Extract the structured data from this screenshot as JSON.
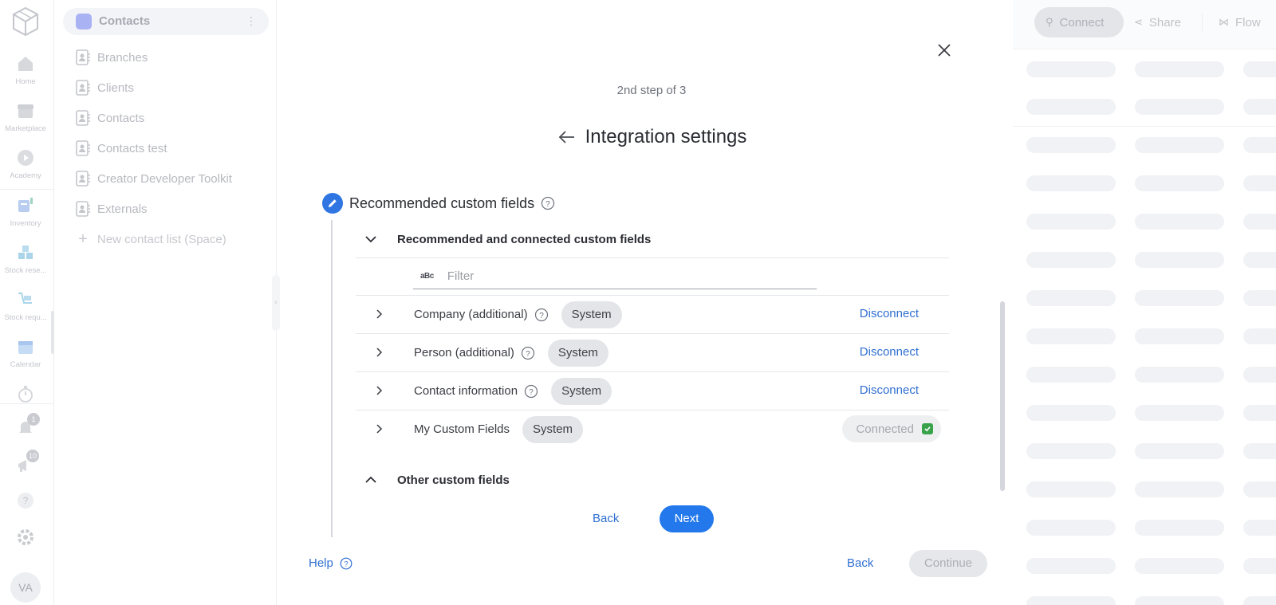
{
  "rail": {
    "items": [
      {
        "label": "Home",
        "icon": "home-icon"
      },
      {
        "label": "Marketplace",
        "icon": "store-icon"
      },
      {
        "label": "Academy",
        "icon": "play-icon"
      },
      {
        "label": "Inventory",
        "icon": "inventory-icon"
      },
      {
        "label": "Stock rese...",
        "icon": "boxes-icon"
      },
      {
        "label": "Stock requ...",
        "icon": "cart-icon"
      },
      {
        "label": "Calendar",
        "icon": "calendar-icon"
      }
    ],
    "notifications_count": "1",
    "announcements_count": "10",
    "avatar_initials": "VA"
  },
  "sidebar": {
    "title": "Contacts",
    "items": [
      {
        "label": "Branches"
      },
      {
        "label": "Clients"
      },
      {
        "label": "Contacts"
      },
      {
        "label": "Contacts test"
      },
      {
        "label": "Creator Developer Toolkit"
      },
      {
        "label": "Externals"
      }
    ],
    "new_item_label": "New contact list (Space)"
  },
  "toolbar": {
    "connect_label": "Connect",
    "share_label": "Share",
    "flow_label": "Flow"
  },
  "modal": {
    "step_text": "2nd step of 3",
    "title": "Integration settings",
    "section_title": "Recommended custom fields",
    "group_connected_label": "Recommended and connected custom fields",
    "filter_placeholder": "Filter",
    "filter_icon_text": "aBc",
    "rows": [
      {
        "name": "Company (additional)",
        "tag": "System",
        "action": "Disconnect",
        "has_help": true
      },
      {
        "name": "Person (additional)",
        "tag": "System",
        "action": "Disconnect",
        "has_help": true
      },
      {
        "name": "Contact information",
        "tag": "System",
        "action": "Disconnect",
        "has_help": true
      },
      {
        "name": "My Custom Fields",
        "tag": "System",
        "status": "Connected",
        "has_help": false
      }
    ],
    "group_other_label": "Other custom fields",
    "inner_back_label": "Back",
    "inner_next_label": "Next",
    "help_label": "Help",
    "footer_back_label": "Back",
    "continue_label": "Continue"
  },
  "colors": {
    "accent": "#2378ec",
    "link": "#2f6fd0",
    "success": "#38a34a",
    "edit_badge": "#2f76e3"
  }
}
